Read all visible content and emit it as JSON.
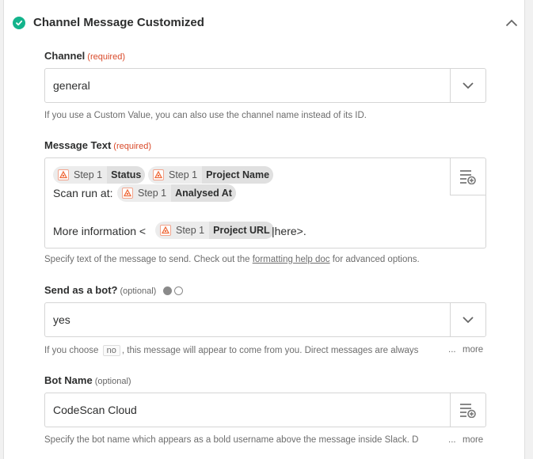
{
  "header": {
    "title": "Channel Message Customized",
    "status_icon": "check-circle-icon",
    "accent": "#13b48c"
  },
  "channel": {
    "label": "Channel",
    "tag": "(required)",
    "value": "general",
    "help": "If you use a Custom Value, you can also use the channel name instead of its ID."
  },
  "message": {
    "label": "Message Text",
    "tag": "(required)",
    "scan_prefix": "Scan run at:",
    "more_prefix": "More information <",
    "more_suffix": "|here>.",
    "pills": [
      {
        "step": "Step 1",
        "field": "Status"
      },
      {
        "step": "Step 1",
        "field": "Project Name"
      },
      {
        "step": "Step 1",
        "field": "Analysed At"
      },
      {
        "step": "Step 1",
        "field": "Project URL"
      }
    ],
    "help_before": "Specify text of the message to send. Check out the ",
    "help_link": "formatting help doc",
    "help_after": " for advanced options."
  },
  "bot": {
    "label": "Send as a bot?",
    "tag": "(optional)",
    "value": "yes",
    "help_before": "If you choose ",
    "help_code": "no",
    "help_after": ", this message will appear to come from you. Direct messages are always",
    "ellipsis": "...",
    "more": "more"
  },
  "bot_name": {
    "label": "Bot Name",
    "tag": "(optional)",
    "value": "CodeScan Cloud",
    "help": "Specify the bot name which appears as a bold username above the message inside Slack. D",
    "ellipsis": "...",
    "more": "more"
  }
}
